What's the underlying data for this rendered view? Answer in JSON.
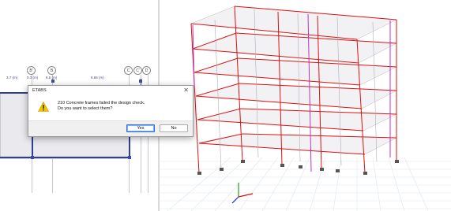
{
  "header": {
    "cropped_title": ""
  },
  "plan": {
    "grid_bubbles": [
      "B'",
      "B",
      "C",
      "C'",
      "D"
    ],
    "dimensions": [
      "3.7 (m)",
      "0.3 (m)",
      "6.5 (m)",
      "8.65 (m)"
    ]
  },
  "dialog": {
    "title": "ETABS",
    "close_glyph": "✕",
    "message_line1": "210 Concrete frames failed the design check.",
    "message_line2": "Do you want to select them?",
    "yes_label": "Yes",
    "no_label": "No",
    "icon": "warning-icon"
  },
  "colors": {
    "frame_fail": "#e01010",
    "brace": "#c030c0",
    "grid": "#dde6ec",
    "plan_beam": "#2f3f93",
    "dialog_button_focus": "#2b6fd8"
  }
}
